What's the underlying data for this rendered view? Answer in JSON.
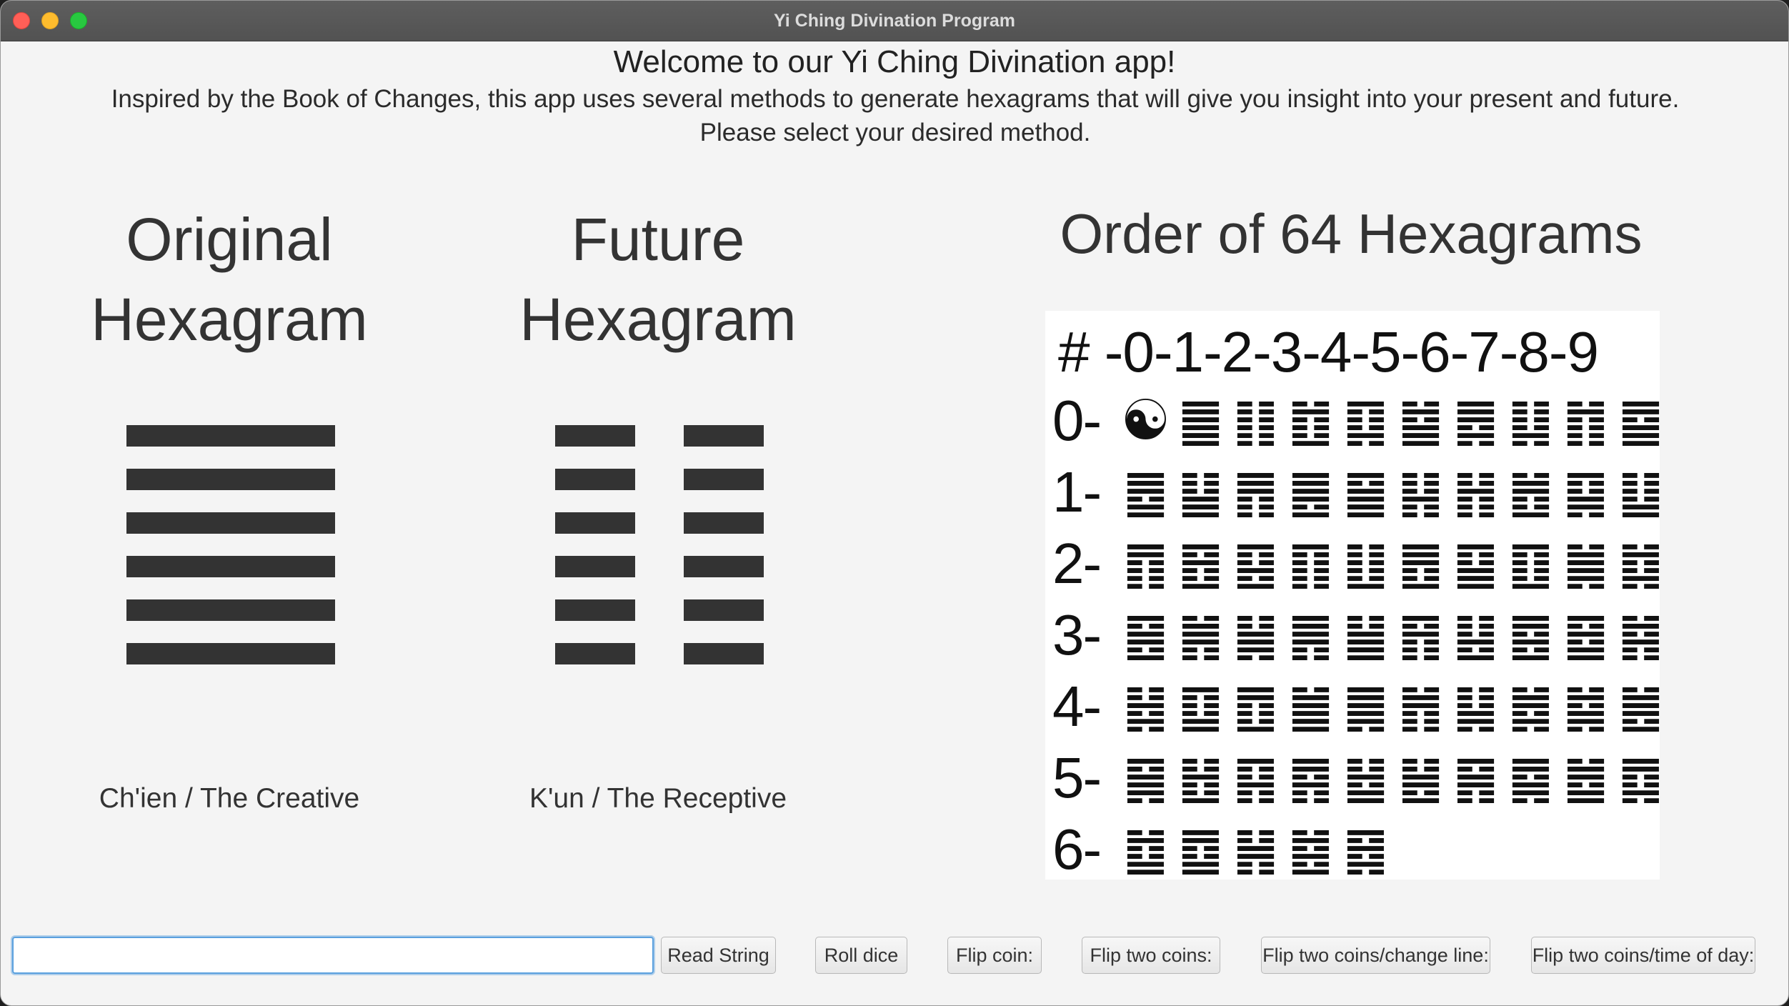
{
  "window": {
    "title": "Yi Ching Divination Program"
  },
  "header": {
    "welcome": "Welcome to our Yi Ching Divination app!",
    "intro_line1": "Inspired by the Book of Changes, this app uses several methods to generate hexagrams that will give you insight into your present and future.",
    "intro_line2": "Please select your desired method."
  },
  "original": {
    "title_line1": "Original",
    "title_line2": "Hexagram",
    "lines": [
      "yang",
      "yang",
      "yang",
      "yang",
      "yang",
      "yang"
    ],
    "name": "Ch'ien / The Creative"
  },
  "future": {
    "title_line1": "Future",
    "title_line2": "Hexagram",
    "lines": [
      "yin",
      "yin",
      "yin",
      "yin",
      "yin",
      "yin"
    ],
    "name": "K'un / The Receptive"
  },
  "order": {
    "title": "Order of 64 Hexagrams",
    "header": "# -0-1-2-3-4-5-6-7-8-9",
    "rows": [
      {
        "label": "0-",
        "cells": [
          "☯",
          "䷀",
          "䷁",
          "䷂",
          "䷃",
          "䷄",
          "䷅",
          "䷆",
          "䷇",
          "䷈"
        ]
      },
      {
        "label": "1-",
        "cells": [
          "䷉",
          "䷊",
          "䷋",
          "䷌",
          "䷍",
          "䷎",
          "䷏",
          "䷐",
          "䷑",
          "䷒"
        ]
      },
      {
        "label": "2-",
        "cells": [
          "䷓",
          "䷔",
          "䷕",
          "䷖",
          "䷗",
          "䷘",
          "䷙",
          "䷚",
          "䷛",
          "䷜"
        ]
      },
      {
        "label": "3-",
        "cells": [
          "䷝",
          "䷞",
          "䷟",
          "䷠",
          "䷡",
          "䷢",
          "䷣",
          "䷤",
          "䷥",
          "䷦"
        ]
      },
      {
        "label": "4-",
        "cells": [
          "䷧",
          "䷨",
          "䷩",
          "䷪",
          "䷫",
          "䷬",
          "䷭",
          "䷮",
          "䷯",
          "䷰"
        ]
      },
      {
        "label": "5-",
        "cells": [
          "䷱",
          "䷲",
          "䷳",
          "䷴",
          "䷵",
          "䷶",
          "䷷",
          "䷸",
          "䷹",
          "䷺"
        ]
      },
      {
        "label": "6-",
        "cells": [
          "䷻",
          "䷼",
          "䷽",
          "䷾",
          "䷿"
        ]
      }
    ]
  },
  "controls": {
    "input_value": "",
    "read_string": "Read String",
    "roll_dice": "Roll dice",
    "flip_coin": "Flip coin:",
    "flip_two": "Flip two coins:",
    "flip_two_change": "Flip two coins/change line:",
    "flip_two_time": "Flip two coins/time of day:"
  }
}
